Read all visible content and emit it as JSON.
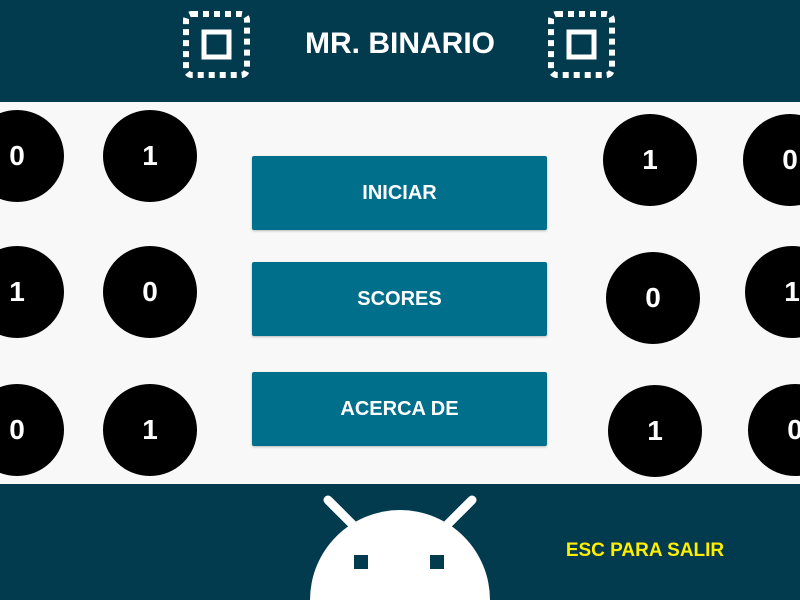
{
  "header": {
    "title": "MR. BINARIO",
    "left_icon": "memory-chip-icon",
    "right_icon": "memory-chip-icon"
  },
  "menu": {
    "start_label": "INICIAR",
    "scores_label": "SCORES",
    "about_label": "ACERCA DE"
  },
  "bits": {
    "left": [
      [
        "0",
        "1"
      ],
      [
        "1",
        "0"
      ],
      [
        "0",
        "1"
      ]
    ],
    "right": [
      [
        "1",
        "0"
      ],
      [
        "0",
        "1"
      ],
      [
        "1",
        "0"
      ]
    ]
  },
  "footer": {
    "mascot_icon": "android-robot-icon",
    "exit_hint": "ESC PARA SALIR"
  },
  "colors": {
    "header_bg": "#023a4e",
    "content_bg": "#f8f8f8",
    "button_bg": "#006f8c",
    "bit_bg": "#000000",
    "hint_color": "#ffee00"
  }
}
